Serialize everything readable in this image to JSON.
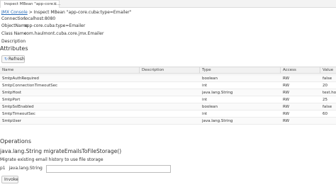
{
  "tab": {
    "label": "Inspect MBean \"app-core.c...",
    "close": "×"
  },
  "breadcrumb": {
    "link": "JMX Console",
    "rest": " > Inspect MBean \"app-core.cuba:type=Emailer\""
  },
  "fields": [
    {
      "label": "Connection",
      "value": "localhost:8080"
    },
    {
      "label": "ObjectName",
      "value": "app-core.cuba:type=Emailer"
    },
    {
      "label": "Class Name",
      "value": "com.haulmont.cuba.core.jmx.Emailer"
    },
    {
      "label": "Description",
      "value": ""
    }
  ],
  "attributes": {
    "title": "Attributes",
    "refresh_label": "Refresh",
    "columns": [
      "Name",
      "Description",
      "Type",
      "Access",
      "Value"
    ],
    "partial_row": {
      "name": "",
      "description": "",
      "type": "java.lang.String",
      "access": "RW",
      "value": ""
    },
    "rows": [
      {
        "name": "SmtpAuthRequired",
        "description": "",
        "type": "boolean",
        "access": "RW",
        "value": "false"
      },
      {
        "name": "SmtpConnectionTimeoutSec",
        "description": "",
        "type": "int",
        "access": "RW",
        "value": "20"
      },
      {
        "name": "SmtpHost",
        "description": "",
        "type": "java.lang.String",
        "access": "RW",
        "value": "test.host"
      },
      {
        "name": "SmtpPort",
        "description": "",
        "type": "int",
        "access": "RW",
        "value": "25"
      },
      {
        "name": "SmtpSslEnabled",
        "description": "",
        "type": "boolean",
        "access": "RW",
        "value": "false"
      },
      {
        "name": "SmtpTimeoutSec",
        "description": "",
        "type": "int",
        "access": "RW",
        "value": "60"
      },
      {
        "name": "SmtpUser",
        "description": "",
        "type": "java.lang.String",
        "access": "RW",
        "value": ""
      }
    ]
  },
  "operations": {
    "title": "Operations",
    "signature": "java.lang.String migrateEmailsToFileStorage()",
    "description": "Migrate existing email history to use file storage",
    "param_index": "p1",
    "param_type": "java.lang.String",
    "param_value": "",
    "invoke_label": "Invoke"
  },
  "icons": {
    "refresh": "refresh-icon",
    "close": "close-icon"
  }
}
